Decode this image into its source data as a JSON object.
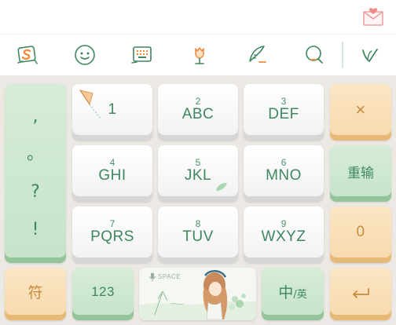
{
  "toolbar": {
    "icons": [
      "sogou-logo-icon",
      "emoji-face-icon",
      "keyboard-layout-icon",
      "tulip-skin-icon",
      "handwriting-quill-icon",
      "search-icon",
      "collapse-chevron-icon"
    ]
  },
  "keys": {
    "punct": [
      ",",
      "。",
      "?",
      "!"
    ],
    "k1": {
      "num": "",
      "label": "1"
    },
    "k2": {
      "num": "2",
      "label": "ABC"
    },
    "k3": {
      "num": "3",
      "label": "DEF"
    },
    "k4": {
      "num": "4",
      "label": "GHI"
    },
    "k5": {
      "num": "5",
      "label": "JKL"
    },
    "k6": {
      "num": "6",
      "label": "MNO"
    },
    "k7": {
      "num": "7",
      "label": "PQRS"
    },
    "k8": {
      "num": "8",
      "label": "TUV"
    },
    "k9": {
      "num": "9",
      "label": "WXYZ"
    },
    "backspace": "×",
    "retype": "重输",
    "zero": "0",
    "symbols": "符",
    "numbers": "123",
    "space": "SPACE",
    "lang": "中",
    "lang_sub": "/英",
    "enter": "↵"
  },
  "colors": {
    "accent_green": "#3f8760",
    "key_green": "#c6e3c9",
    "key_orange": "#f7d9ad"
  }
}
